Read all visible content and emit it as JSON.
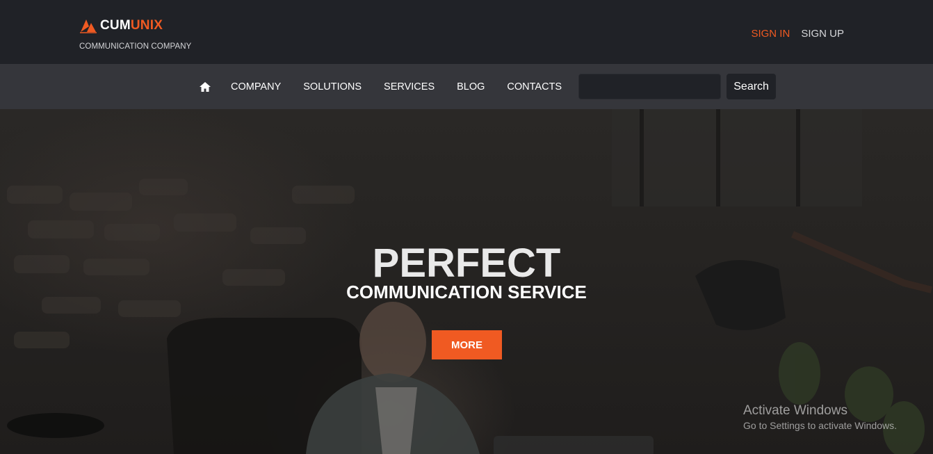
{
  "brand": {
    "name_part1": "CUM",
    "name_part2": "UNIX",
    "tagline": "COMMUNICATION COMPANY",
    "logo_icon": "sail-icon",
    "accent_color": "#f05a22"
  },
  "auth": {
    "sign_in": "SIGN IN",
    "sign_up": "SIGN UP"
  },
  "nav": {
    "home_icon": "home-icon",
    "items": [
      "COMPANY",
      "SOLUTIONS",
      "SERVICES",
      "BLOG",
      "CONTACTS"
    ],
    "search": {
      "placeholder": "",
      "value": "",
      "button_label": "Search"
    }
  },
  "hero": {
    "title": "PERFECT",
    "subtitle": "COMMUNICATION SERVICE",
    "button_label": "MORE"
  },
  "watermark": {
    "line1": "Activate Windows",
    "line2": "Go to Settings to activate Windows."
  }
}
